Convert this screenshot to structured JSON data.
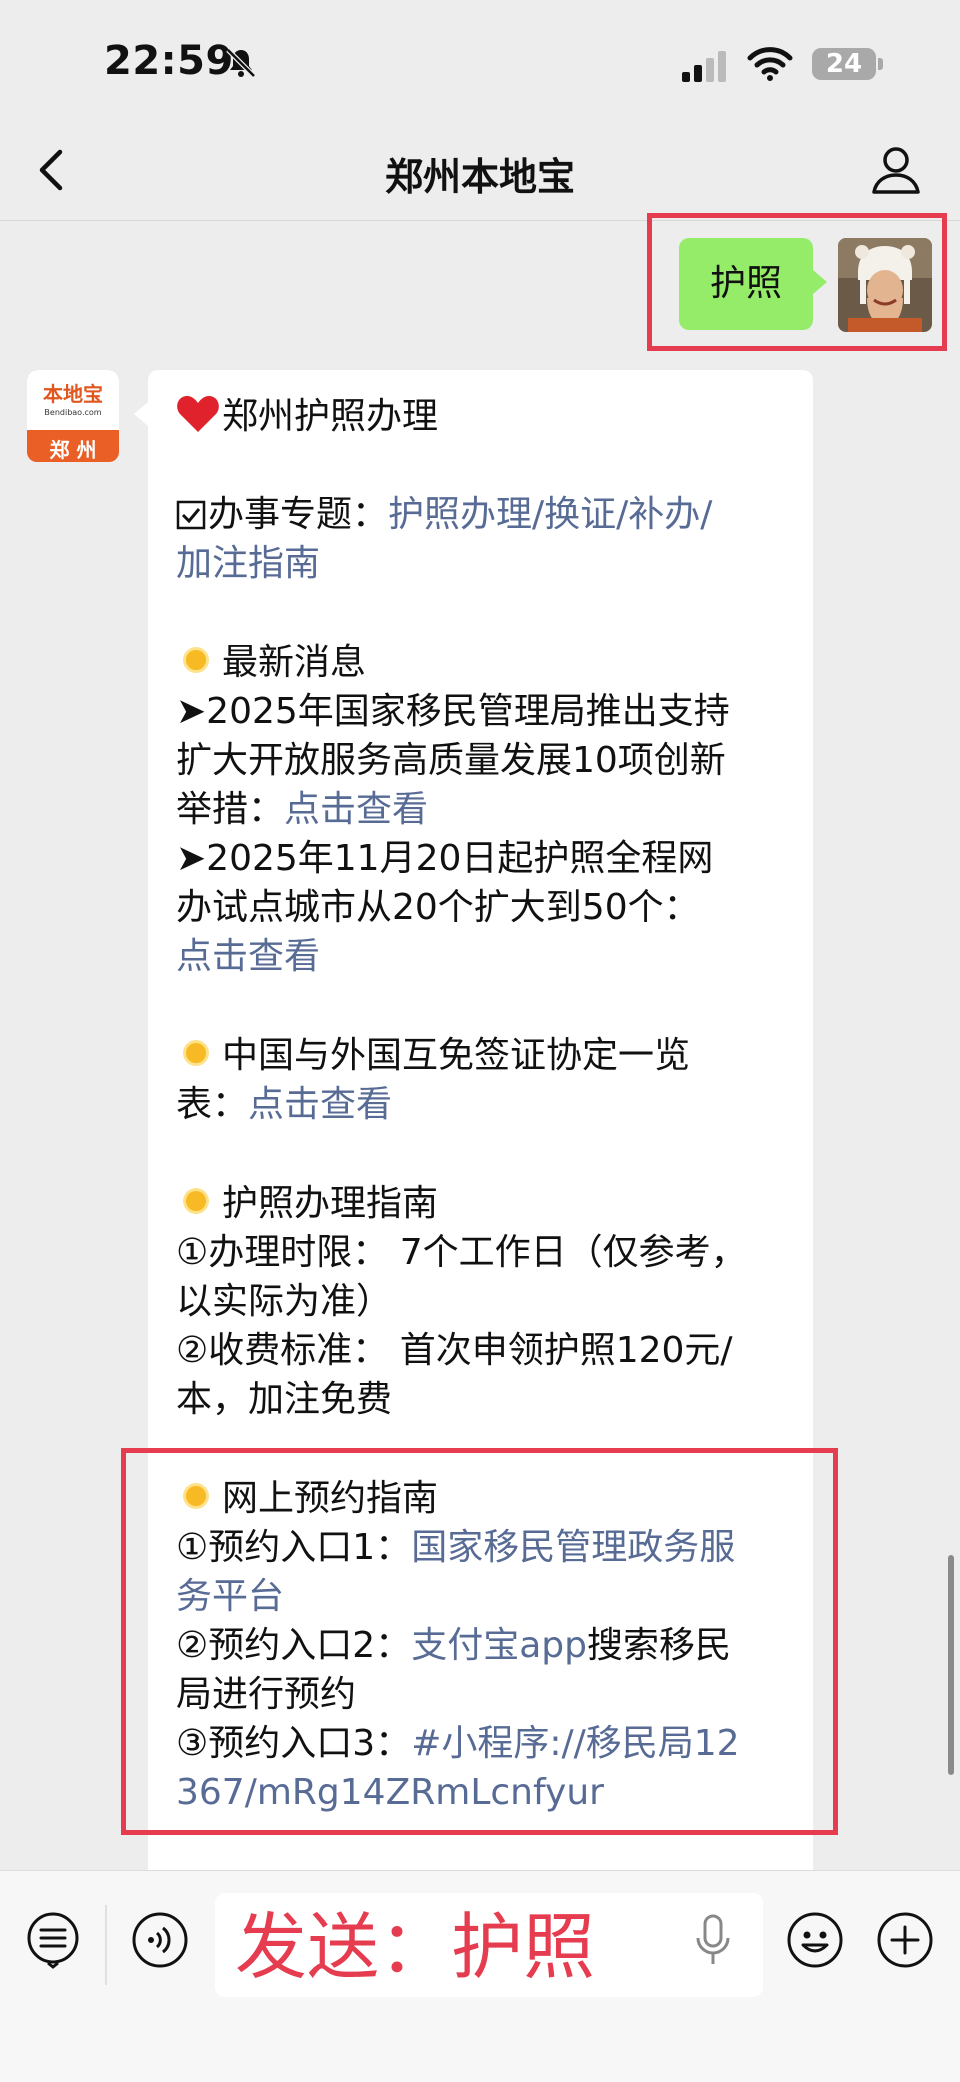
{
  "status_bar": {
    "time": "22:59",
    "battery": "24"
  },
  "nav": {
    "title": "郑州本地宝"
  },
  "sent_message": {
    "text": "护照"
  },
  "brand_avatar": {
    "logo": "本地宝",
    "url": "Bendibao.com",
    "city": "郑 州"
  },
  "message": {
    "title": "郑州护照办理",
    "topic_prefix": "办事专题：",
    "topic_link_line1": "护照办理/换证/补办/",
    "topic_link_line2": "加注指南",
    "news_heading": "最新消息",
    "news1_line1": "➤2025年国家移民管理局推出支持",
    "news1_line2": "扩大开放服务高质量发展10项创新",
    "news1_line3_prefix": "举措：",
    "news1_link": "点击查看",
    "news2_line1": "➤2025年11月20日起护照全程网",
    "news2_line2": "办试点城市从20个扩大到50个：",
    "news2_link": "点击查看",
    "visa_line1": "中国与外国互免签证协定一览",
    "visa_line2_prefix": "表：",
    "visa_link": "点击查看",
    "guide_heading": "护照办理指南",
    "guide_line1": "①办理时限：  7个工作日（仅参考，",
    "guide_line2": "以实际为准）",
    "guide_line3": "②收费标准：  首次申领护照120元/",
    "guide_line4": "本，加注免费",
    "online_heading": "网上预约指南",
    "online1_prefix": "①预约入口1：",
    "online1_link_line1": "国家移民管理政务服",
    "online1_link_line2": "务平台",
    "online2_prefix": "②预约入口2：",
    "online2_link": "支付宝app",
    "online2_suffix": "搜索移民",
    "online2_line2": "局进行预约",
    "online3_prefix": "③预约入口3：",
    "online3_link_line1": "#小程序://移民局12",
    "online3_link_line2": "367/mRg14ZRmLcnfyur"
  },
  "input_bar": {
    "overlay_text": "发送：护照"
  },
  "colors": {
    "accent_red": "#e63c4f",
    "sent_bubble": "#95ec69",
    "link": "#576b95"
  }
}
